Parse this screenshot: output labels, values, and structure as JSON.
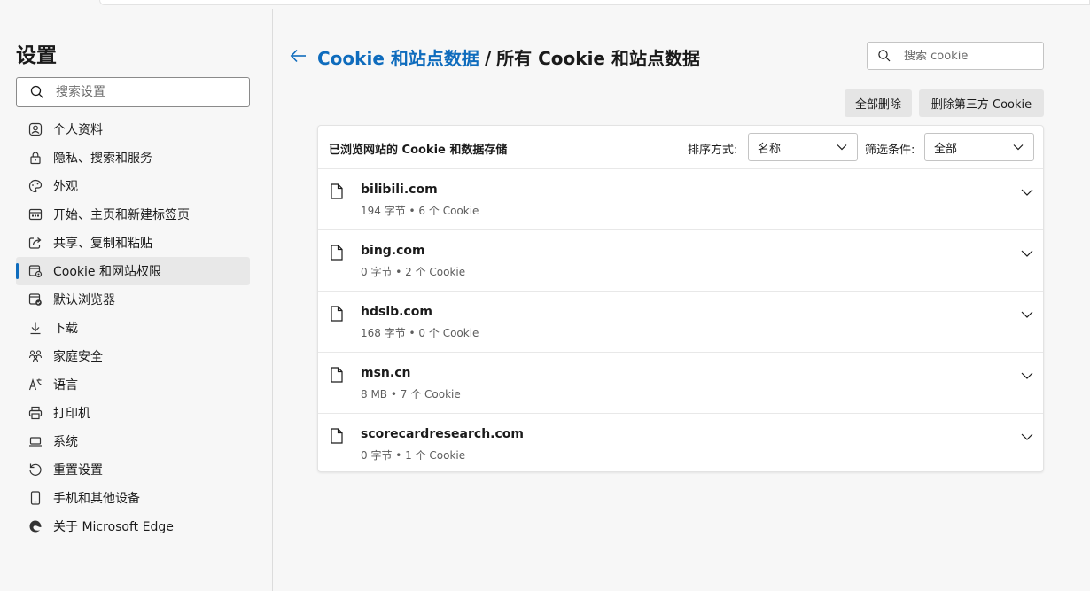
{
  "sidebar": {
    "title": "设置",
    "search_placeholder": "搜索设置",
    "items": [
      {
        "label": "个人资料",
        "icon": "profile-icon"
      },
      {
        "label": "隐私、搜索和服务",
        "icon": "lock-icon"
      },
      {
        "label": "外观",
        "icon": "palette-icon"
      },
      {
        "label": "开始、主页和新建标签页",
        "icon": "home-tabs-icon"
      },
      {
        "label": "共享、复制和粘贴",
        "icon": "share-icon"
      },
      {
        "label": "Cookie 和网站权限",
        "icon": "cookie-permissions-icon",
        "active": true
      },
      {
        "label": "默认浏览器",
        "icon": "default-browser-icon"
      },
      {
        "label": "下载",
        "icon": "download-icon"
      },
      {
        "label": "家庭安全",
        "icon": "family-icon"
      },
      {
        "label": "语言",
        "icon": "language-icon"
      },
      {
        "label": "打印机",
        "icon": "printer-icon"
      },
      {
        "label": "系统",
        "icon": "system-icon"
      },
      {
        "label": "重置设置",
        "icon": "reset-icon"
      },
      {
        "label": "手机和其他设备",
        "icon": "phone-icon"
      },
      {
        "label": "关于 Microsoft Edge",
        "icon": "edge-icon"
      }
    ]
  },
  "header": {
    "breadcrumb_link": "Cookie 和站点数据",
    "separator": "/",
    "current": "所有 Cookie 和站点数据",
    "search_placeholder": "搜索 cookie"
  },
  "actions": {
    "delete_all": "全部删除",
    "delete_third_party": "删除第三方 Cookie"
  },
  "card": {
    "title": "已浏览网站的 Cookie 和数据存储",
    "sort_label": "排序方式:",
    "sort_value": "名称",
    "filter_label": "筛选条件:",
    "filter_value": "全部",
    "sites": [
      {
        "name": "bilibili.com",
        "meta": "194 字节 • 6 个 Cookie"
      },
      {
        "name": "bing.com",
        "meta": "0 字节 • 2 个 Cookie"
      },
      {
        "name": "hdslb.com",
        "meta": "168 字节 • 0 个 Cookie"
      },
      {
        "name": "msn.cn",
        "meta": "8 MB • 7 个 Cookie"
      },
      {
        "name": "scorecardresearch.com",
        "meta": "0 字节 • 1 个 Cookie"
      }
    ]
  },
  "colors": {
    "accent": "#0f6cbd",
    "background": "#f7f7f7",
    "card": "#ffffff"
  }
}
